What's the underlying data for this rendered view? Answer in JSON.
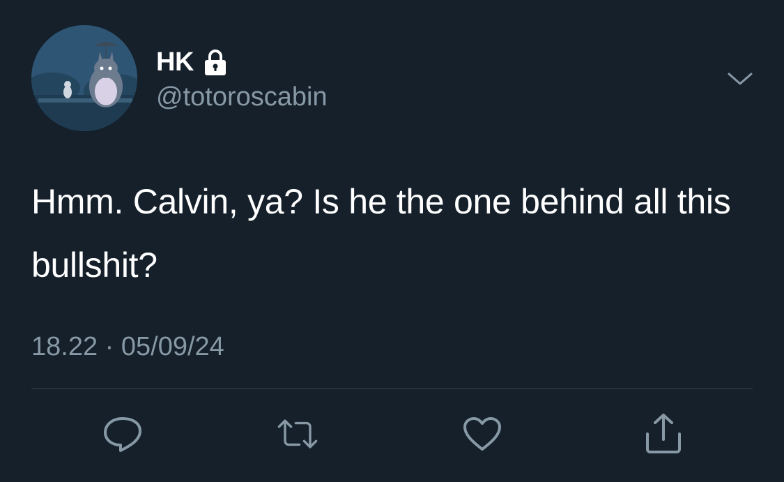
{
  "user": {
    "display_name": "HK",
    "handle": "@totoroscabin",
    "protected": true,
    "avatar_icon": "totoro-avatar"
  },
  "tweet": {
    "text": "Hmm. Calvin, ya? Is he the one behind all this bullshit?",
    "timestamp": "18.22 · 05/09/24"
  },
  "actions": [
    {
      "name": "reply",
      "icon": "reply-icon"
    },
    {
      "name": "retweet",
      "icon": "retweet-icon"
    },
    {
      "name": "like",
      "icon": "heart-icon"
    },
    {
      "name": "share",
      "icon": "share-icon"
    }
  ],
  "colors": {
    "background": "#15202b",
    "primary_text": "#ffffff",
    "secondary_text": "#8899a6",
    "divider": "#38444d"
  }
}
